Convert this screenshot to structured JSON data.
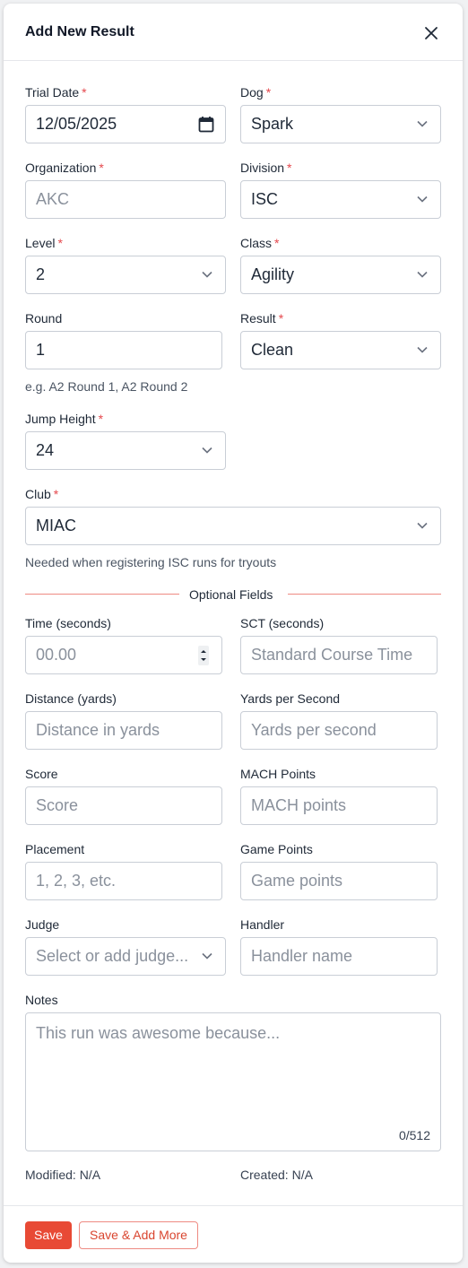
{
  "modal": {
    "title": "Add New Result",
    "close_icon": "close-icon"
  },
  "required_mark": "*",
  "fields": {
    "trial_date": {
      "label": "Trial Date",
      "value": "12/05/2025"
    },
    "dog": {
      "label": "Dog",
      "value": "Spark"
    },
    "organization": {
      "label": "Organization",
      "value": "AKC"
    },
    "division": {
      "label": "Division",
      "value": "ISC"
    },
    "level": {
      "label": "Level",
      "value": "2"
    },
    "class": {
      "label": "Class",
      "value": "Agility"
    },
    "round": {
      "label": "Round",
      "value": "1",
      "helper": "e.g. A2 Round 1, A2 Round 2"
    },
    "result": {
      "label": "Result",
      "value": "Clean"
    },
    "jump_height": {
      "label": "Jump Height",
      "value": "24"
    },
    "club": {
      "label": "Club",
      "value": "MIAC",
      "helper": "Needed when registering ISC runs for tryouts"
    }
  },
  "optional_section": {
    "heading": "Optional Fields",
    "time": {
      "label": "Time (seconds)",
      "placeholder": "00.00"
    },
    "sct": {
      "label": "SCT (seconds)",
      "placeholder": "Standard Course Time"
    },
    "distance": {
      "label": "Distance (yards)",
      "placeholder": "Distance in yards"
    },
    "yps": {
      "label": "Yards per Second",
      "placeholder": "Yards per second"
    },
    "score": {
      "label": "Score",
      "placeholder": "Score"
    },
    "mach": {
      "label": "MACH Points",
      "placeholder": "MACH points"
    },
    "placement": {
      "label": "Placement",
      "placeholder": "1, 2, 3, etc."
    },
    "game_points": {
      "label": "Game Points",
      "placeholder": "Game points"
    },
    "judge": {
      "label": "Judge",
      "placeholder": "Select or add judge..."
    },
    "handler": {
      "label": "Handler",
      "placeholder": "Handler name"
    },
    "notes": {
      "label": "Notes",
      "placeholder": "This run was awesome because...",
      "count": "0/512"
    }
  },
  "meta": {
    "modified": "Modified: N/A",
    "created": "Created: N/A"
  },
  "footer": {
    "save_label": "Save",
    "save_add_more_label": "Save & Add More"
  },
  "colors": {
    "accent": "#e84a35",
    "required": "#e5484d",
    "divider": "#ee8a82"
  }
}
